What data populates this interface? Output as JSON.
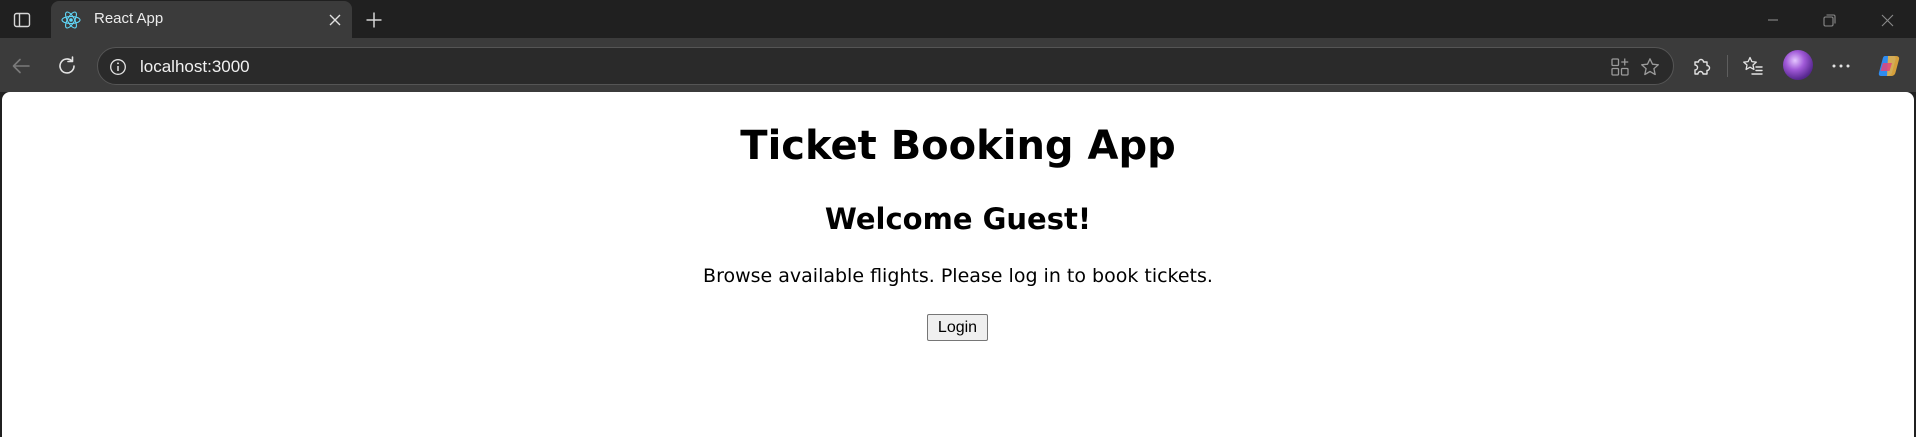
{
  "browser": {
    "tab": {
      "title": "React App",
      "favicon": "react-logo-icon"
    },
    "address_bar": {
      "url": "localhost:3000"
    },
    "icons": {
      "tab_actions": "tab-actions-icon",
      "close_tab": "close-icon",
      "new_tab": "plus-icon",
      "minimize": "minimize-icon",
      "restore": "restore-icon",
      "close_window": "close-icon",
      "back": "arrow-left-icon",
      "reload": "reload-icon",
      "site_info": "info-icon",
      "app_available": "app-available-icon",
      "favorite": "star-icon",
      "extensions": "puzzle-icon",
      "favorites": "favorites-list-icon",
      "more": "more-icon",
      "copilot": "copilot-icon"
    },
    "colors": {
      "frame": "#202020",
      "toolbar": "#3b3b3b",
      "omnibox": "#2a2a2a",
      "page": "#ffffff"
    }
  },
  "page": {
    "title": "Ticket Booking App",
    "welcome": "Welcome Guest!",
    "message": "Browse available flights. Please log in to book tickets.",
    "login_label": "Login"
  }
}
